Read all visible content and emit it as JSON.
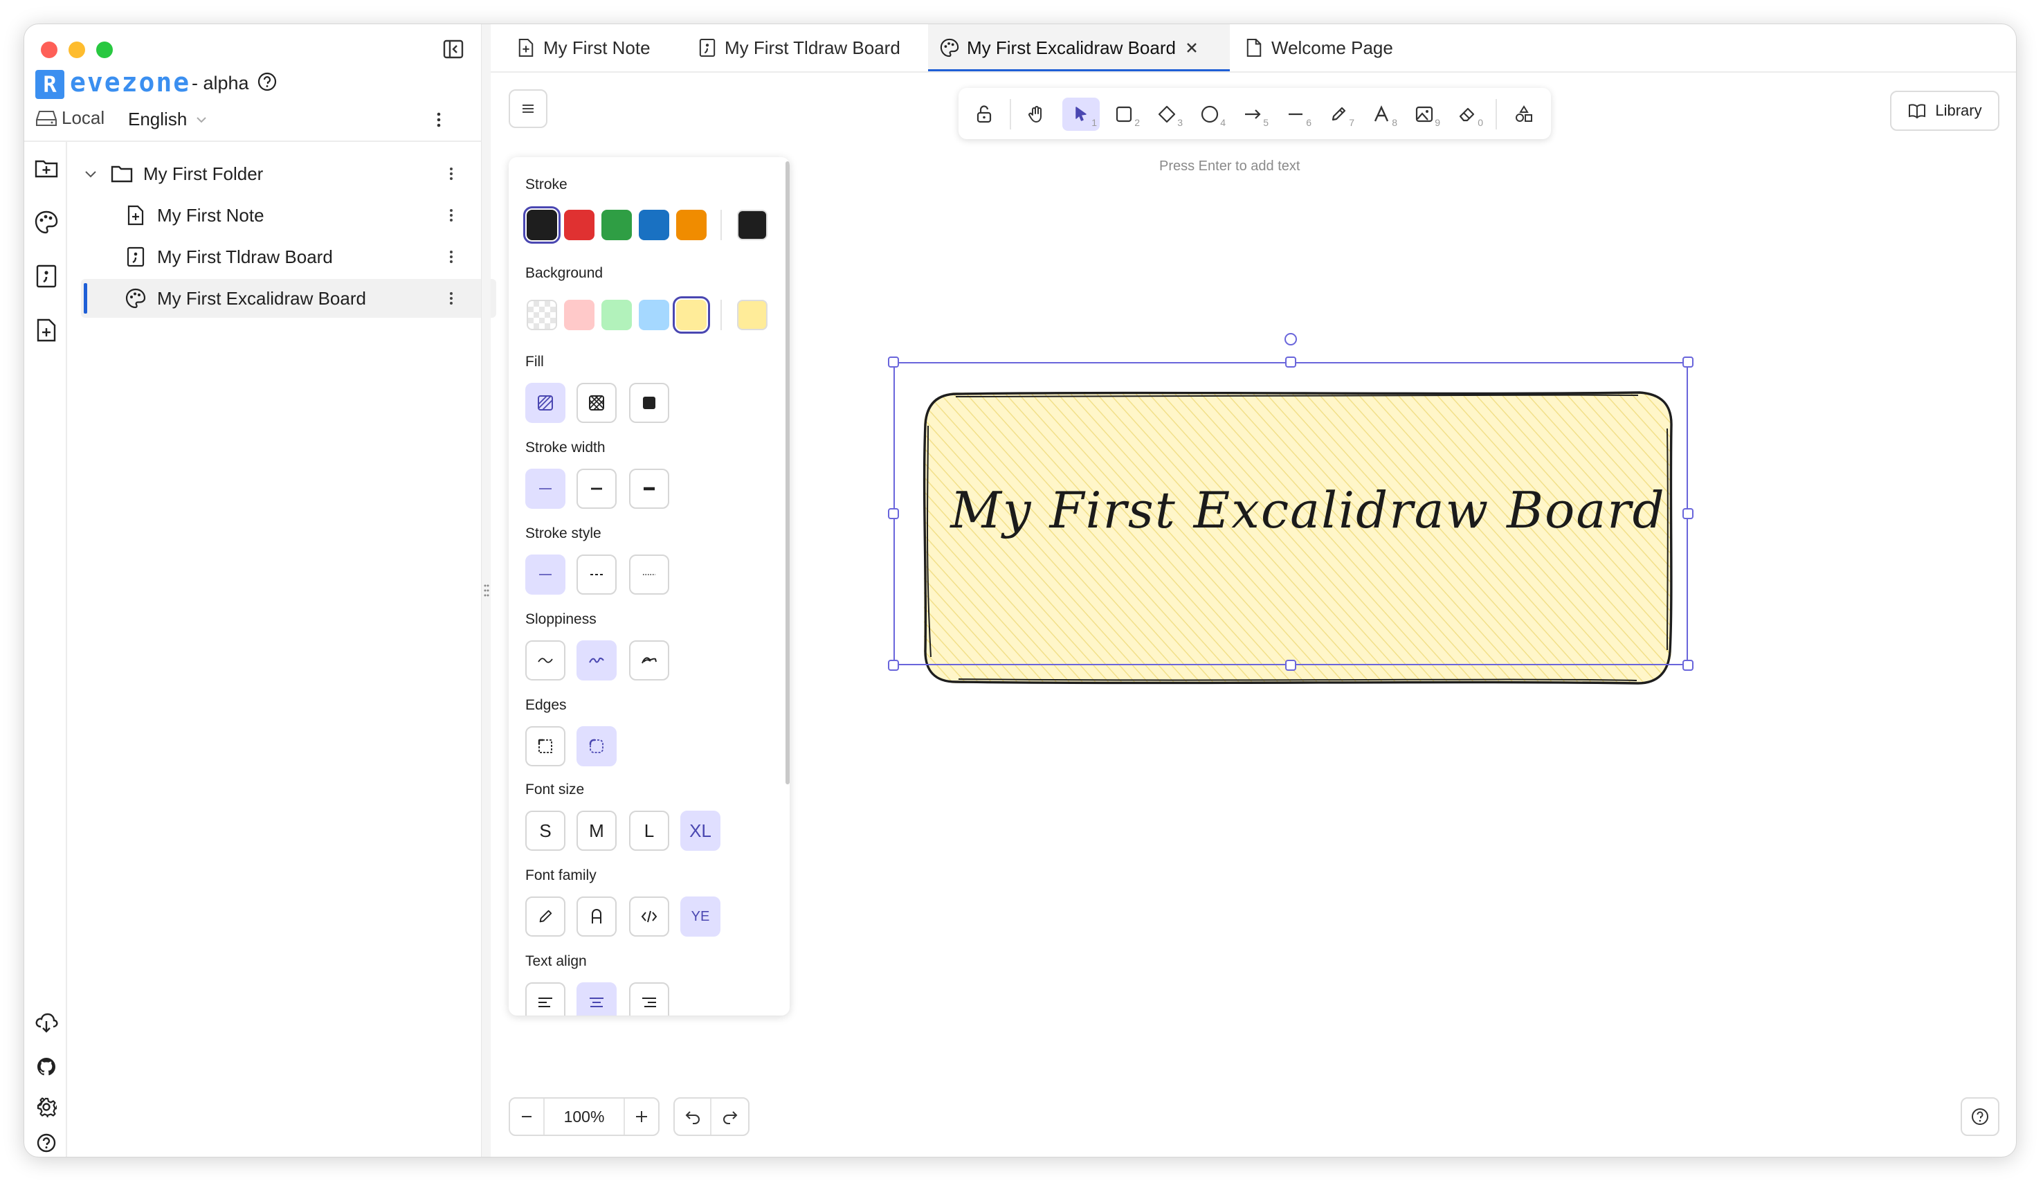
{
  "app": {
    "logo_letter": "R",
    "logo_rest": "evezone",
    "edition": "- alpha"
  },
  "workspace": {
    "storage_label": "Local",
    "language_label": "English"
  },
  "tree": {
    "folder": "My First Folder",
    "items": [
      {
        "label": "My First Note",
        "icon": "note-icon"
      },
      {
        "label": "My First Tldraw Board",
        "icon": "tldraw-icon"
      },
      {
        "label": "My First Excalidraw Board",
        "icon": "palette-icon"
      }
    ]
  },
  "tabs": [
    {
      "label": "My First Note",
      "icon": "note-icon"
    },
    {
      "label": "My First Tldraw Board",
      "icon": "tldraw-icon"
    },
    {
      "label": "My First Excalidraw Board",
      "icon": "palette-icon",
      "active": true
    },
    {
      "label": "Welcome Page",
      "icon": "page-icon"
    }
  ],
  "toolbar": {
    "tools": [
      {
        "name": "lock",
        "num": ""
      },
      {
        "name": "hand",
        "num": ""
      },
      {
        "name": "selection",
        "num": "1"
      },
      {
        "name": "rectangle",
        "num": "2"
      },
      {
        "name": "diamond",
        "num": "3"
      },
      {
        "name": "ellipse",
        "num": "4"
      },
      {
        "name": "arrow",
        "num": "5"
      },
      {
        "name": "line",
        "num": "6"
      },
      {
        "name": "draw",
        "num": "7"
      },
      {
        "name": "text",
        "num": "8"
      },
      {
        "name": "image",
        "num": "9"
      },
      {
        "name": "eraser",
        "num": "0"
      },
      {
        "name": "shapes",
        "num": ""
      }
    ],
    "hint": "Press Enter to add text"
  },
  "library_label": "Library",
  "panel": {
    "stroke_title": "Stroke",
    "stroke_colors": [
      "#1e1e1e",
      "#e03131",
      "#2f9e44",
      "#1971c2",
      "#f08c00"
    ],
    "stroke_current": "#1e1e1e",
    "background_title": "Background",
    "background_colors": [
      "transparent",
      "#ffc9c9",
      "#b2f2bb",
      "#a5d8ff",
      "#ffec99"
    ],
    "background_current": "#ffec99",
    "fill_title": "Fill",
    "stroke_width_title": "Stroke width",
    "stroke_style_title": "Stroke style",
    "sloppiness_title": "Sloppiness",
    "edges_title": "Edges",
    "font_size_title": "Font size",
    "font_sizes": [
      "S",
      "M",
      "L",
      "XL"
    ],
    "font_family_title": "Font family",
    "font_family_last": "YE",
    "text_align_title": "Text align"
  },
  "board": {
    "text": "My First Excalidraw Board",
    "fill_color": "#fff6c9",
    "hatch_color": "#f2e08a"
  },
  "zoom": {
    "value": "100%"
  }
}
